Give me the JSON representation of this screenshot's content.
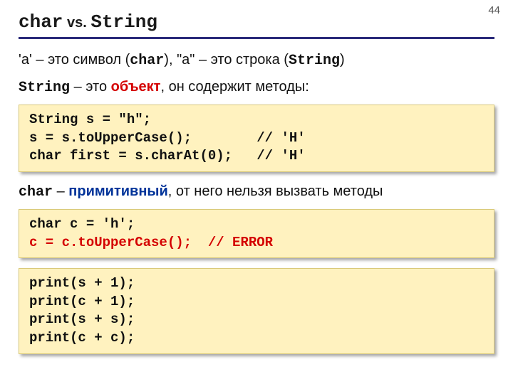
{
  "pageNumber": "44",
  "title": {
    "part1": "char",
    "vs": " vs. ",
    "part2": "String"
  },
  "line1": {
    "t1": "'a' – это символ (",
    "m1": "char",
    "t2": "), \"a\" – это строка (",
    "m2": "String",
    "t3": ")"
  },
  "line2": {
    "m1": "String",
    "t1": " – это ",
    "kw": "объект",
    "t2": ", он содержит методы:"
  },
  "code1": "String s = \"h\";\ns = s.toUpperCase();        // 'H'\nchar first = s.charAt(0);   // 'H'",
  "line3": {
    "m1": "char",
    "t1": " – ",
    "kw": "примитивный",
    "t2": ", от него нельзя вызвать методы"
  },
  "code2": {
    "l1": "char c = 'h';",
    "l2": "c = c.toUpperCase();  // ERROR"
  },
  "code3": "print(s + 1);\nprint(c + 1);\nprint(s + s);\nprint(c + c);"
}
